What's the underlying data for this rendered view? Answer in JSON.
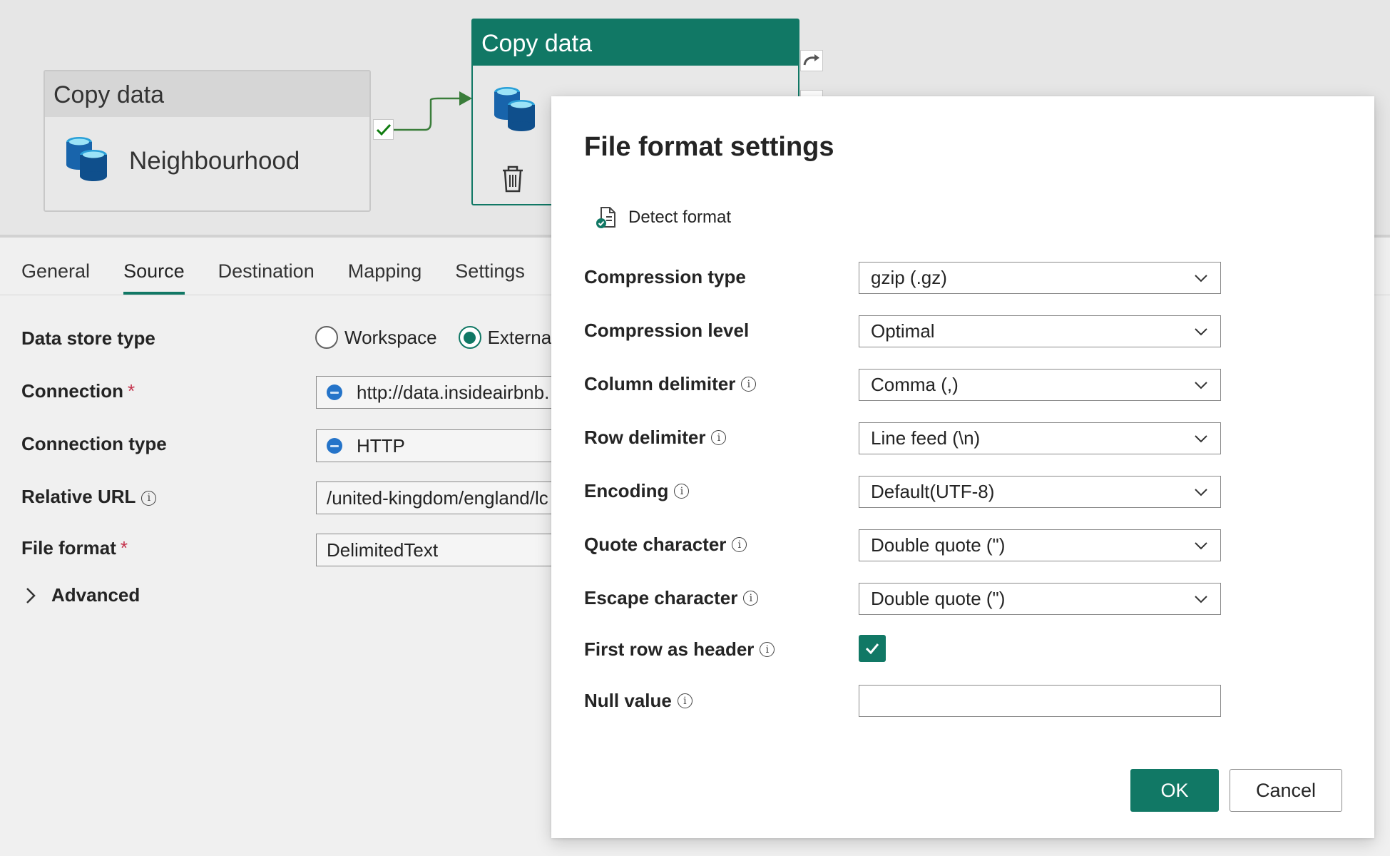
{
  "canvas": {
    "activity1": {
      "title": "Copy data",
      "name": "Neighbourhood"
    },
    "activity2": {
      "title": "Copy data"
    }
  },
  "panel": {
    "tabs": [
      "General",
      "Source",
      "Destination",
      "Mapping",
      "Settings"
    ],
    "active_tab": "Source",
    "data_store_type_label": "Data store type",
    "radio_workspace": "Workspace",
    "radio_external": "External",
    "connection_label": "Connection",
    "connection_value": "http://data.insideairbnb.",
    "connection_type_label": "Connection type",
    "connection_type_value": "HTTP",
    "relative_url_label": "Relative URL",
    "relative_url_value": "/united-kingdom/england/lc",
    "file_format_label": "File format",
    "file_format_value": "DelimitedText",
    "advanced_label": "Advanced",
    "required_mark": "*"
  },
  "dialog": {
    "title": "File format settings",
    "detect_format": "Detect format",
    "fields": [
      {
        "label": "Compression type",
        "value": "gzip (.gz)"
      },
      {
        "label": "Compression level",
        "value": "Optimal"
      },
      {
        "label": "Column delimiter",
        "value": "Comma (,)"
      },
      {
        "label": "Row delimiter",
        "value": "Line feed (\\n)"
      },
      {
        "label": "Encoding",
        "value": "Default(UTF-8)"
      },
      {
        "label": "Quote character",
        "value": "Double quote (\")"
      },
      {
        "label": "Escape character",
        "value": "Double quote (\")"
      }
    ],
    "first_row_header_label": "First row as header",
    "first_row_header_checked": true,
    "null_value_label": "Null value",
    "null_value": "",
    "ok": "OK",
    "cancel": "Cancel"
  },
  "colors": {
    "accent": "#117865",
    "required": "#c4314b"
  }
}
